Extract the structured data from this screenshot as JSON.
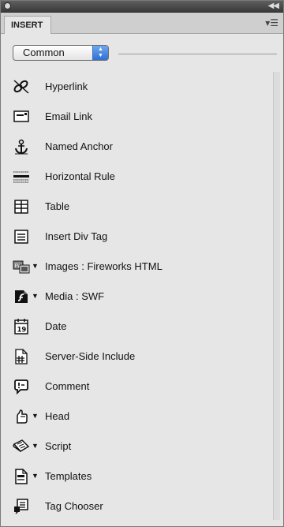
{
  "panel": {
    "tab_label": "INSERT",
    "category": "Common"
  },
  "items": [
    {
      "label": "Hyperlink",
      "icon": "hyperlink-icon",
      "has_dropdown": false
    },
    {
      "label": "Email Link",
      "icon": "email-link-icon",
      "has_dropdown": false
    },
    {
      "label": "Named Anchor",
      "icon": "anchor-icon",
      "has_dropdown": false
    },
    {
      "label": "Horizontal Rule",
      "icon": "horizontal-rule-icon",
      "has_dropdown": false
    },
    {
      "label": "Table",
      "icon": "table-icon",
      "has_dropdown": false
    },
    {
      "label": "Insert Div Tag",
      "icon": "div-tag-icon",
      "has_dropdown": false
    },
    {
      "label": "Images : Fireworks HTML",
      "icon": "fireworks-image-icon",
      "has_dropdown": true
    },
    {
      "label": "Media : SWF",
      "icon": "flash-media-icon",
      "has_dropdown": true
    },
    {
      "label": "Date",
      "icon": "calendar-icon",
      "has_dropdown": false
    },
    {
      "label": "Server-Side Include",
      "icon": "server-include-icon",
      "has_dropdown": false
    },
    {
      "label": "Comment",
      "icon": "comment-icon",
      "has_dropdown": false
    },
    {
      "label": "Head",
      "icon": "head-icon",
      "has_dropdown": true
    },
    {
      "label": "Script",
      "icon": "script-icon",
      "has_dropdown": true
    },
    {
      "label": "Templates",
      "icon": "templates-icon",
      "has_dropdown": true
    },
    {
      "label": "Tag Chooser",
      "icon": "tag-chooser-icon",
      "has_dropdown": false
    }
  ]
}
